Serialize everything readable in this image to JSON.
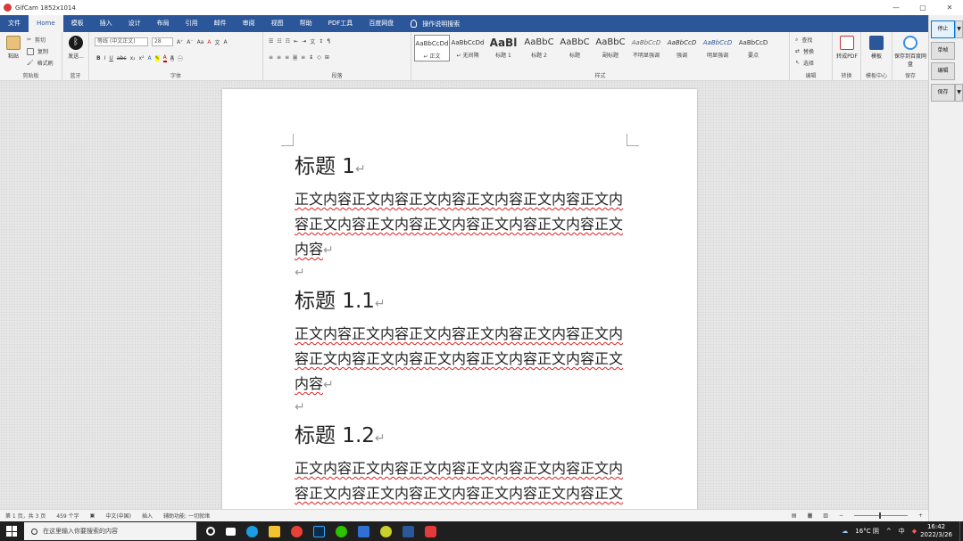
{
  "window": {
    "title": "GifCam 1852x1014",
    "min": "—",
    "max": "▢",
    "close": "✕"
  },
  "menu": {
    "items": [
      "文件",
      "Home",
      "模板",
      "插入",
      "设计",
      "布局",
      "引用",
      "邮件",
      "审阅",
      "视图",
      "帮助",
      "PDF工具",
      "百度网盘"
    ],
    "active_index": 1,
    "tell_me": "操作说明搜索"
  },
  "ribbon": {
    "clipboard": {
      "paste": "粘贴",
      "cut": "剪切",
      "copy": "复制",
      "format_painter": "格式刷",
      "label": "剪贴板"
    },
    "bluetooth": {
      "label_big": "发送...",
      "label": "蓝牙"
    },
    "font": {
      "name": "等线 (中文正文)",
      "size": "28",
      "bold": "B",
      "italic": "I",
      "underline": "U",
      "strike": "abc",
      "sub": "x₂",
      "sup": "x²",
      "label": "字体"
    },
    "paragraph": {
      "label": "段落"
    },
    "styles": {
      "items": [
        {
          "sample": "AaBbCcDd",
          "name": "↵ 正文"
        },
        {
          "sample": "AaBbCcDd",
          "name": "↵ 无间隔"
        },
        {
          "sample": "AaBl",
          "name": "标题 1"
        },
        {
          "sample": "AaBbC",
          "name": "标题 2"
        },
        {
          "sample": "AaBbC",
          "name": "标题"
        },
        {
          "sample": "AaBbC",
          "name": "副标题"
        },
        {
          "sample": "AaBbCcD",
          "name": "不明显强调"
        },
        {
          "sample": "AaBbCcD",
          "name": "强调"
        },
        {
          "sample": "AaBbCcD",
          "name": "明显强调"
        },
        {
          "sample": "AaBbCcD",
          "name": "要点"
        }
      ],
      "label": "样式"
    },
    "editing": {
      "find": "查找",
      "replace": "替换",
      "select": "选择",
      "label": "编辑"
    },
    "convert": {
      "btn": "转成PDF",
      "label": "转换"
    },
    "template": {
      "btn": "模板",
      "label": "模板中心"
    },
    "save": {
      "btn": "保存到百度网盘",
      "label": "保存"
    }
  },
  "gifcam": {
    "stop": "停止",
    "single": "单帧",
    "edit": "编辑",
    "save": "保存",
    "arrow": "▼"
  },
  "document": {
    "sections": [
      {
        "heading": "标题 1",
        "line1": "正文内容正文内容正文内容正文内容正文内容正文内",
        "line2": "容正文内容正文内容正文内容正文内容正文内容正文",
        "line3": "内容"
      },
      {
        "heading": "标题 1.1",
        "line1": "正文内容正文内容正文内容正文内容正文内容正文内",
        "line2": "容正文内容正文内容正文内容正文内容正文内容正文",
        "line3": "内容"
      },
      {
        "heading": "标题 1.2",
        "line1": "正文内容正文内容正文内容正文内容正文内容正文内",
        "line2": "容正文内容正文内容正文内容正文内容正文内容正文",
        "line3": ""
      }
    ],
    "para_mark": "↵"
  },
  "status": {
    "page": "第 1 页，共 3 页",
    "words": "459 个字",
    "lang": "中文(中国)",
    "mode": "插入",
    "access": "辅助功能: 一切就绪"
  },
  "taskbar": {
    "search_placeholder": "在这里输入你要搜索的内容",
    "weather": "16°C 阴",
    "ime": "中",
    "time": "16:42",
    "date": "2022/3/26"
  }
}
